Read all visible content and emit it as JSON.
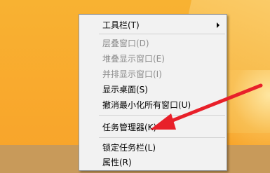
{
  "context_menu": {
    "items": [
      {
        "label": "工具栏(T)",
        "disabled": false,
        "submenu": true
      },
      {
        "label": "层叠窗口(D)",
        "disabled": true
      },
      {
        "label": "堆叠显示窗口(E)",
        "disabled": true
      },
      {
        "label": "并排显示窗口(I)",
        "disabled": true
      },
      {
        "label": "显示桌面(S)",
        "disabled": false
      },
      {
        "label": "撤消最小化所有窗口(U)",
        "disabled": false
      },
      {
        "label": "任务管理器(K)",
        "disabled": false
      },
      {
        "label": "锁定任务栏(L)",
        "disabled": false
      },
      {
        "label": "属性(R)",
        "disabled": false
      }
    ]
  },
  "annotation": {
    "color": "#e8202a",
    "points_to": "任务管理器(K)"
  }
}
